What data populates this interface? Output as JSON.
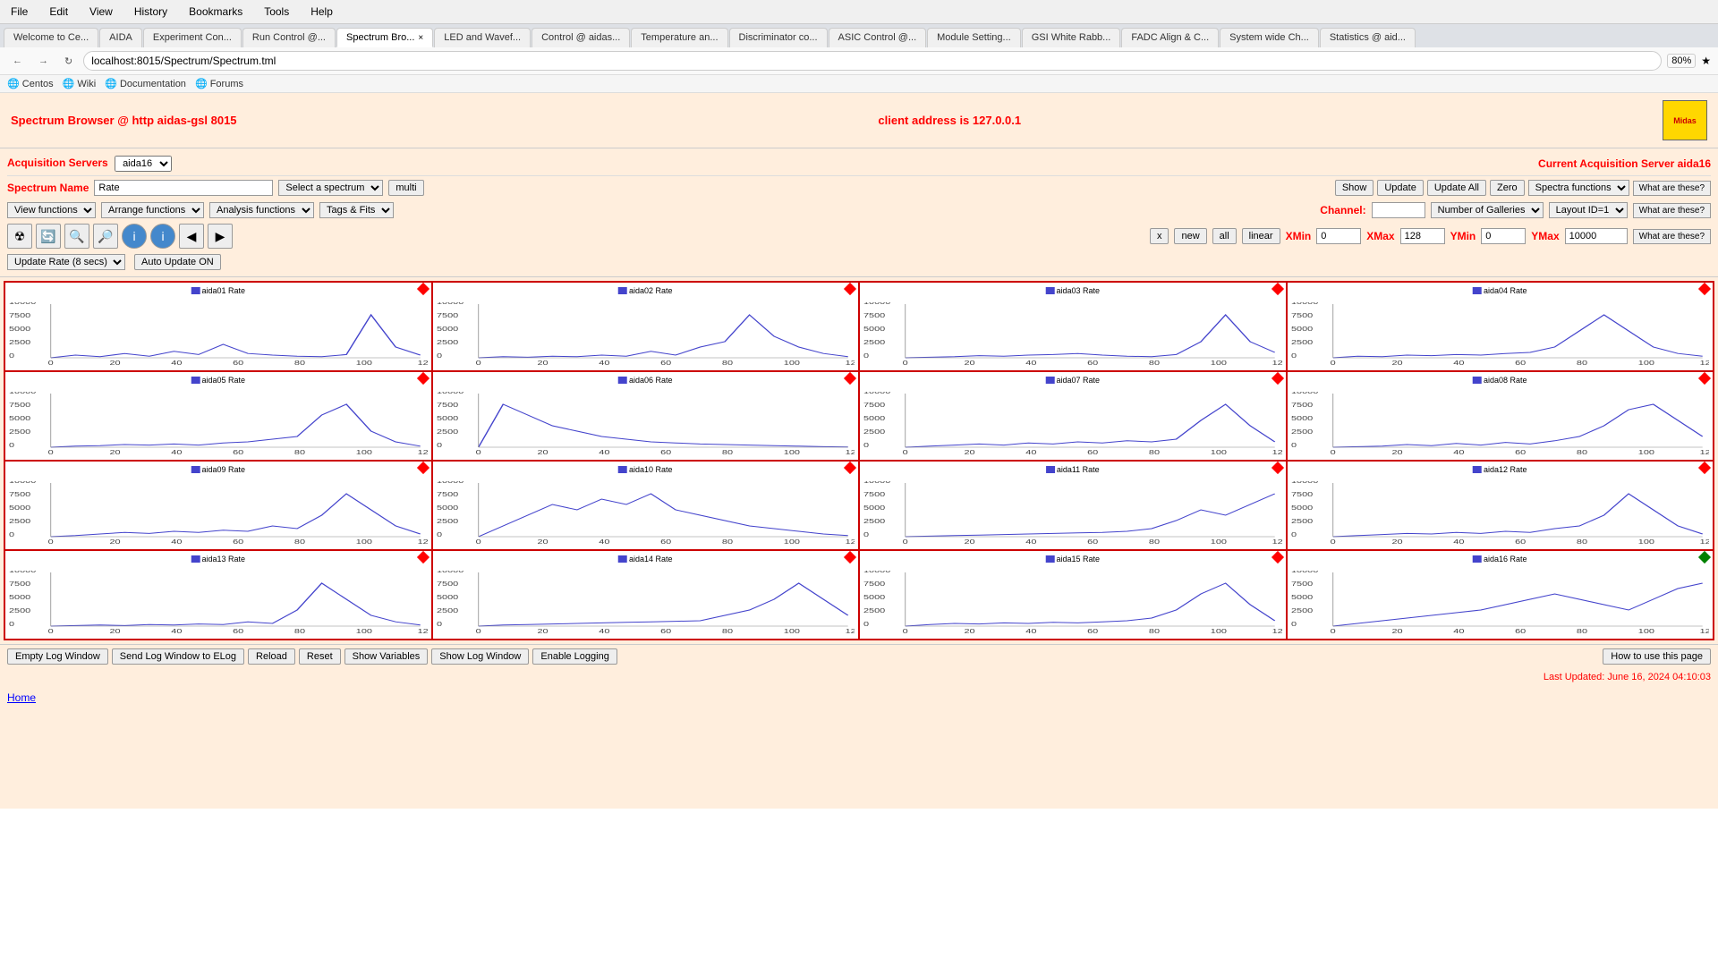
{
  "browser": {
    "menu_items": [
      "File",
      "Edit",
      "View",
      "History",
      "Bookmarks",
      "Tools",
      "Help"
    ],
    "tabs": [
      {
        "label": "Welcome to Ce...",
        "active": false
      },
      {
        "label": "AIDA",
        "active": false
      },
      {
        "label": "Experiment Con...",
        "active": false
      },
      {
        "label": "Run Control @...",
        "active": false
      },
      {
        "label": "Spectrum Bro...",
        "active": true,
        "closable": true
      },
      {
        "label": "LED and Wavef...",
        "active": false
      },
      {
        "label": "Control @ aidas...",
        "active": false
      },
      {
        "label": "Temperature an...",
        "active": false
      },
      {
        "label": "Discriminator co...",
        "active": false
      },
      {
        "label": "ASIC Control @...",
        "active": false
      },
      {
        "label": "Module Setting...",
        "active": false
      },
      {
        "label": "GSI White Rabb...",
        "active": false
      },
      {
        "label": "FADC Align & C...",
        "active": false
      },
      {
        "label": "System wide Ch...",
        "active": false
      },
      {
        "label": "Statistics @ aid...",
        "active": false
      }
    ],
    "address": "localhost:8015/Spectrum/Spectrum.tml",
    "zoom": "80%",
    "bookmarks": [
      "Centos",
      "Wiki",
      "Documentation",
      "Forums"
    ]
  },
  "page": {
    "title": "Spectrum Browser @ http aidas-gsl 8015",
    "client_address": "client address is 127.0.0.1",
    "logo_text": "Midas"
  },
  "controls": {
    "acq_label": "Acquisition Servers",
    "acq_server_value": "aida16",
    "current_server_label": "Current Acquisition Server aida16",
    "spectrum_name_label": "Spectrum Name",
    "spectrum_name_value": "Rate",
    "select_spectrum_label": "Select a spectrum",
    "multi_btn": "multi",
    "show_btn": "Show",
    "update_btn": "Update",
    "update_all_btn": "Update All",
    "zero_btn": "Zero",
    "spectra_functions_label": "Spectra functions",
    "what_these1": "What are these?",
    "view_functions_label": "View functions",
    "arrange_functions_label": "Arrange functions",
    "analysis_functions_label": "Analysis functions",
    "tags_fits_label": "Tags & Fits",
    "channel_label": "Channel:",
    "channel_value": "",
    "number_galleries_label": "Number of Galleries",
    "layout_label": "Layout ID=1",
    "what_these2": "What are these?",
    "x_btn": "x",
    "new_btn": "new",
    "all_btn": "all",
    "linear_btn": "linear",
    "xmin_label": "XMin",
    "xmin_value": "0",
    "xmax_label": "XMax",
    "xmax_value": "128",
    "ymin_label": "YMin",
    "ymin_value": "0",
    "ymax_label": "YMax",
    "ymax_value": "10000",
    "what_these3": "What are these?",
    "update_rate_label": "Update Rate (8 secs)",
    "auto_update_label": "Auto Update ON"
  },
  "charts": [
    {
      "id": "aida01",
      "label": "aida01 Rate",
      "diamond": "red",
      "data": [
        0,
        500,
        200,
        800,
        300,
        1200,
        600,
        2500,
        800,
        500,
        300,
        200,
        600,
        8000,
        2000,
        500
      ]
    },
    {
      "id": "aida02",
      "label": "aida02 Rate",
      "diamond": "red",
      "data": [
        0,
        200,
        100,
        300,
        200,
        500,
        300,
        1200,
        500,
        2000,
        3000,
        8000,
        4000,
        2000,
        800,
        200
      ]
    },
    {
      "id": "aida03",
      "label": "aida03 Rate",
      "diamond": "red",
      "data": [
        0,
        100,
        200,
        400,
        300,
        500,
        600,
        800,
        500,
        300,
        200,
        600,
        3000,
        8000,
        3000,
        1000
      ]
    },
    {
      "id": "aida04",
      "label": "aida04 Rate",
      "diamond": "red",
      "data": [
        0,
        300,
        200,
        500,
        400,
        600,
        500,
        800,
        1000,
        2000,
        5000,
        8000,
        5000,
        2000,
        800,
        300
      ]
    },
    {
      "id": "aida05",
      "label": "aida05 Rate",
      "diamond": "red",
      "data": [
        0,
        200,
        300,
        500,
        400,
        600,
        400,
        800,
        1000,
        1500,
        2000,
        6000,
        8000,
        3000,
        1000,
        200
      ]
    },
    {
      "id": "aida06",
      "label": "aida06 Rate",
      "diamond": "red",
      "data": [
        0,
        8000,
        6000,
        4000,
        3000,
        2000,
        1500,
        1000,
        800,
        600,
        500,
        400,
        300,
        200,
        100,
        50
      ]
    },
    {
      "id": "aida07",
      "label": "aida07 Rate",
      "diamond": "red",
      "data": [
        0,
        200,
        400,
        600,
        400,
        800,
        600,
        1000,
        800,
        1200,
        1000,
        1500,
        5000,
        8000,
        4000,
        1000
      ]
    },
    {
      "id": "aida08",
      "label": "aida08 Rate",
      "diamond": "red",
      "data": [
        0,
        100,
        200,
        500,
        300,
        700,
        400,
        900,
        600,
        1200,
        2000,
        4000,
        7000,
        8000,
        5000,
        2000
      ]
    },
    {
      "id": "aida09",
      "label": "aida09 Rate",
      "diamond": "red",
      "data": [
        0,
        200,
        500,
        800,
        600,
        1000,
        800,
        1200,
        1000,
        2000,
        1500,
        4000,
        8000,
        5000,
        2000,
        500
      ]
    },
    {
      "id": "aida10",
      "label": "aida10 Rate",
      "diamond": "red",
      "data": [
        0,
        2000,
        4000,
        6000,
        5000,
        7000,
        6000,
        8000,
        5000,
        4000,
        3000,
        2000,
        1500,
        1000,
        500,
        200
      ]
    },
    {
      "id": "aida11",
      "label": "aida11 Rate",
      "diamond": "red",
      "data": [
        0,
        100,
        200,
        300,
        400,
        500,
        600,
        700,
        800,
        1000,
        1500,
        3000,
        5000,
        4000,
        6000,
        8000
      ]
    },
    {
      "id": "aida12",
      "label": "aida12 Rate",
      "diamond": "red",
      "data": [
        0,
        200,
        400,
        600,
        500,
        800,
        600,
        1000,
        800,
        1500,
        2000,
        4000,
        8000,
        5000,
        2000,
        500
      ]
    },
    {
      "id": "aida13",
      "label": "aida13 Rate",
      "diamond": "red",
      "data": [
        0,
        100,
        200,
        100,
        300,
        200,
        400,
        300,
        800,
        500,
        3000,
        8000,
        5000,
        2000,
        800,
        200
      ]
    },
    {
      "id": "aida14",
      "label": "aida14 Rate",
      "diamond": "red",
      "data": [
        0,
        200,
        300,
        400,
        500,
        600,
        700,
        800,
        900,
        1000,
        2000,
        3000,
        5000,
        8000,
        5000,
        2000
      ]
    },
    {
      "id": "aida15",
      "label": "aida15 Rate",
      "diamond": "red",
      "data": [
        0,
        300,
        500,
        400,
        600,
        500,
        700,
        600,
        800,
        1000,
        1500,
        3000,
        6000,
        8000,
        4000,
        1000
      ]
    },
    {
      "id": "aida16",
      "label": "aida16 Rate",
      "diamond": "green",
      "data": [
        0,
        500,
        1000,
        1500,
        2000,
        2500,
        3000,
        4000,
        5000,
        6000,
        5000,
        4000,
        3000,
        5000,
        7000,
        8000
      ]
    }
  ],
  "bottom": {
    "empty_log_btn": "Empty Log Window",
    "send_elog_btn": "Send Log Window to ELog",
    "reload_btn": "Reload",
    "reset_btn": "Reset",
    "show_variables_btn": "Show Variables",
    "show_log_btn": "Show Log Window",
    "enable_logging_btn": "Enable Logging",
    "how_use_btn": "How to use this page",
    "last_updated": "Last Updated: June 16, 2024 04:10:03"
  },
  "footer": {
    "home_link": "Home"
  }
}
